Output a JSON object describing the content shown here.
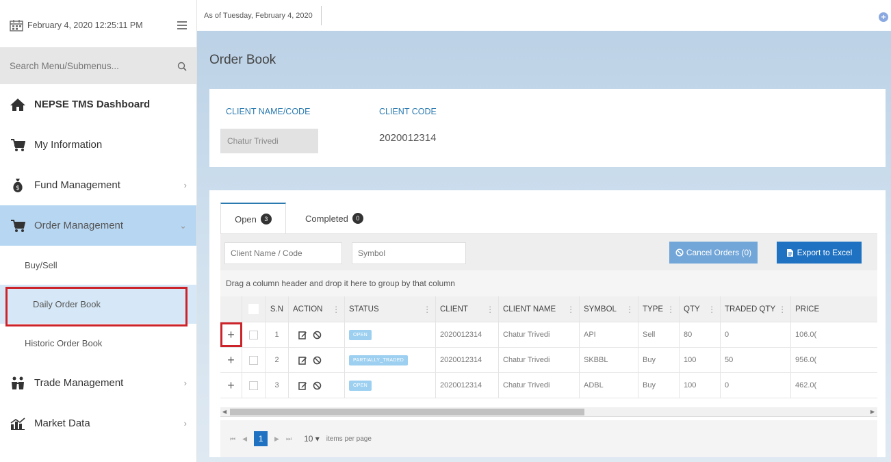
{
  "sidebar": {
    "datetime": "February 4, 2020 12:25:11 PM",
    "search_placeholder": "Search Menu/Submenus...",
    "items": [
      {
        "label": "NEPSE TMS Dashboard"
      },
      {
        "label": "My Information"
      },
      {
        "label": "Fund Management"
      },
      {
        "label": "Order Management"
      },
      {
        "label": "Buy/Sell"
      },
      {
        "label": "Daily Order Book"
      },
      {
        "label": "Historic Order Book"
      },
      {
        "label": "Trade Management"
      },
      {
        "label": "Market Data"
      }
    ]
  },
  "topbar": {
    "as_of": "As of Tuesday, February 4, 2020"
  },
  "page": {
    "title": "Order Book"
  },
  "client_card": {
    "name_label": "CLIENT NAME/CODE",
    "code_label": "CLIENT CODE",
    "name_value": "Chatur Trivedi",
    "code_value": "2020012314"
  },
  "tabs": {
    "open_label": "Open",
    "open_count": "3",
    "completed_label": "Completed",
    "completed_count": "0"
  },
  "toolbar": {
    "client_placeholder": "Client Name / Code",
    "symbol_placeholder": "Symbol",
    "cancel_label": "Cancel Orders (0)",
    "export_label": "Export to Excel"
  },
  "grid": {
    "group_hint": "Drag a column header and drop it here to group by that column",
    "headers": {
      "sn": "S.N",
      "action": "ACTION",
      "status": "STATUS",
      "client": "CLIENT",
      "client_name": "CLIENT NAME",
      "symbol": "SYMBOL",
      "type": "TYPE",
      "qty": "QTY",
      "traded_qty": "TRADED QTY",
      "price": "PRICE"
    },
    "rows": [
      {
        "sn": "1",
        "status": "OPEN",
        "client": "2020012314",
        "client_name": "Chatur Trivedi",
        "symbol": "API",
        "type": "Sell",
        "qty": "80",
        "traded_qty": "0",
        "price": "106.0("
      },
      {
        "sn": "2",
        "status": "PARTIALLY_TRADED",
        "client": "2020012314",
        "client_name": "Chatur Trivedi",
        "symbol": "SKBBL",
        "type": "Buy",
        "qty": "100",
        "traded_qty": "50",
        "price": "956.0("
      },
      {
        "sn": "3",
        "status": "OPEN",
        "client": "2020012314",
        "client_name": "Chatur Trivedi",
        "symbol": "ADBL",
        "type": "Buy",
        "qty": "100",
        "traded_qty": "0",
        "price": "462.0("
      }
    ]
  },
  "pager": {
    "current_page": "1",
    "page_size": "10",
    "items_per_page": "items per page"
  },
  "icons": {
    "calendar": "calendar-icon",
    "menu": "hamburger-icon",
    "search": "search-icon",
    "home": "home-icon",
    "cart": "cart-icon",
    "money_bag": "money-bag-icon",
    "trade": "people-icon",
    "chart": "chart-icon"
  },
  "colors": {
    "accent": "#1f72c2",
    "active_menu": "#b7d6f2",
    "highlight": "#cc2229",
    "status_badge": "#9dd0f0"
  }
}
